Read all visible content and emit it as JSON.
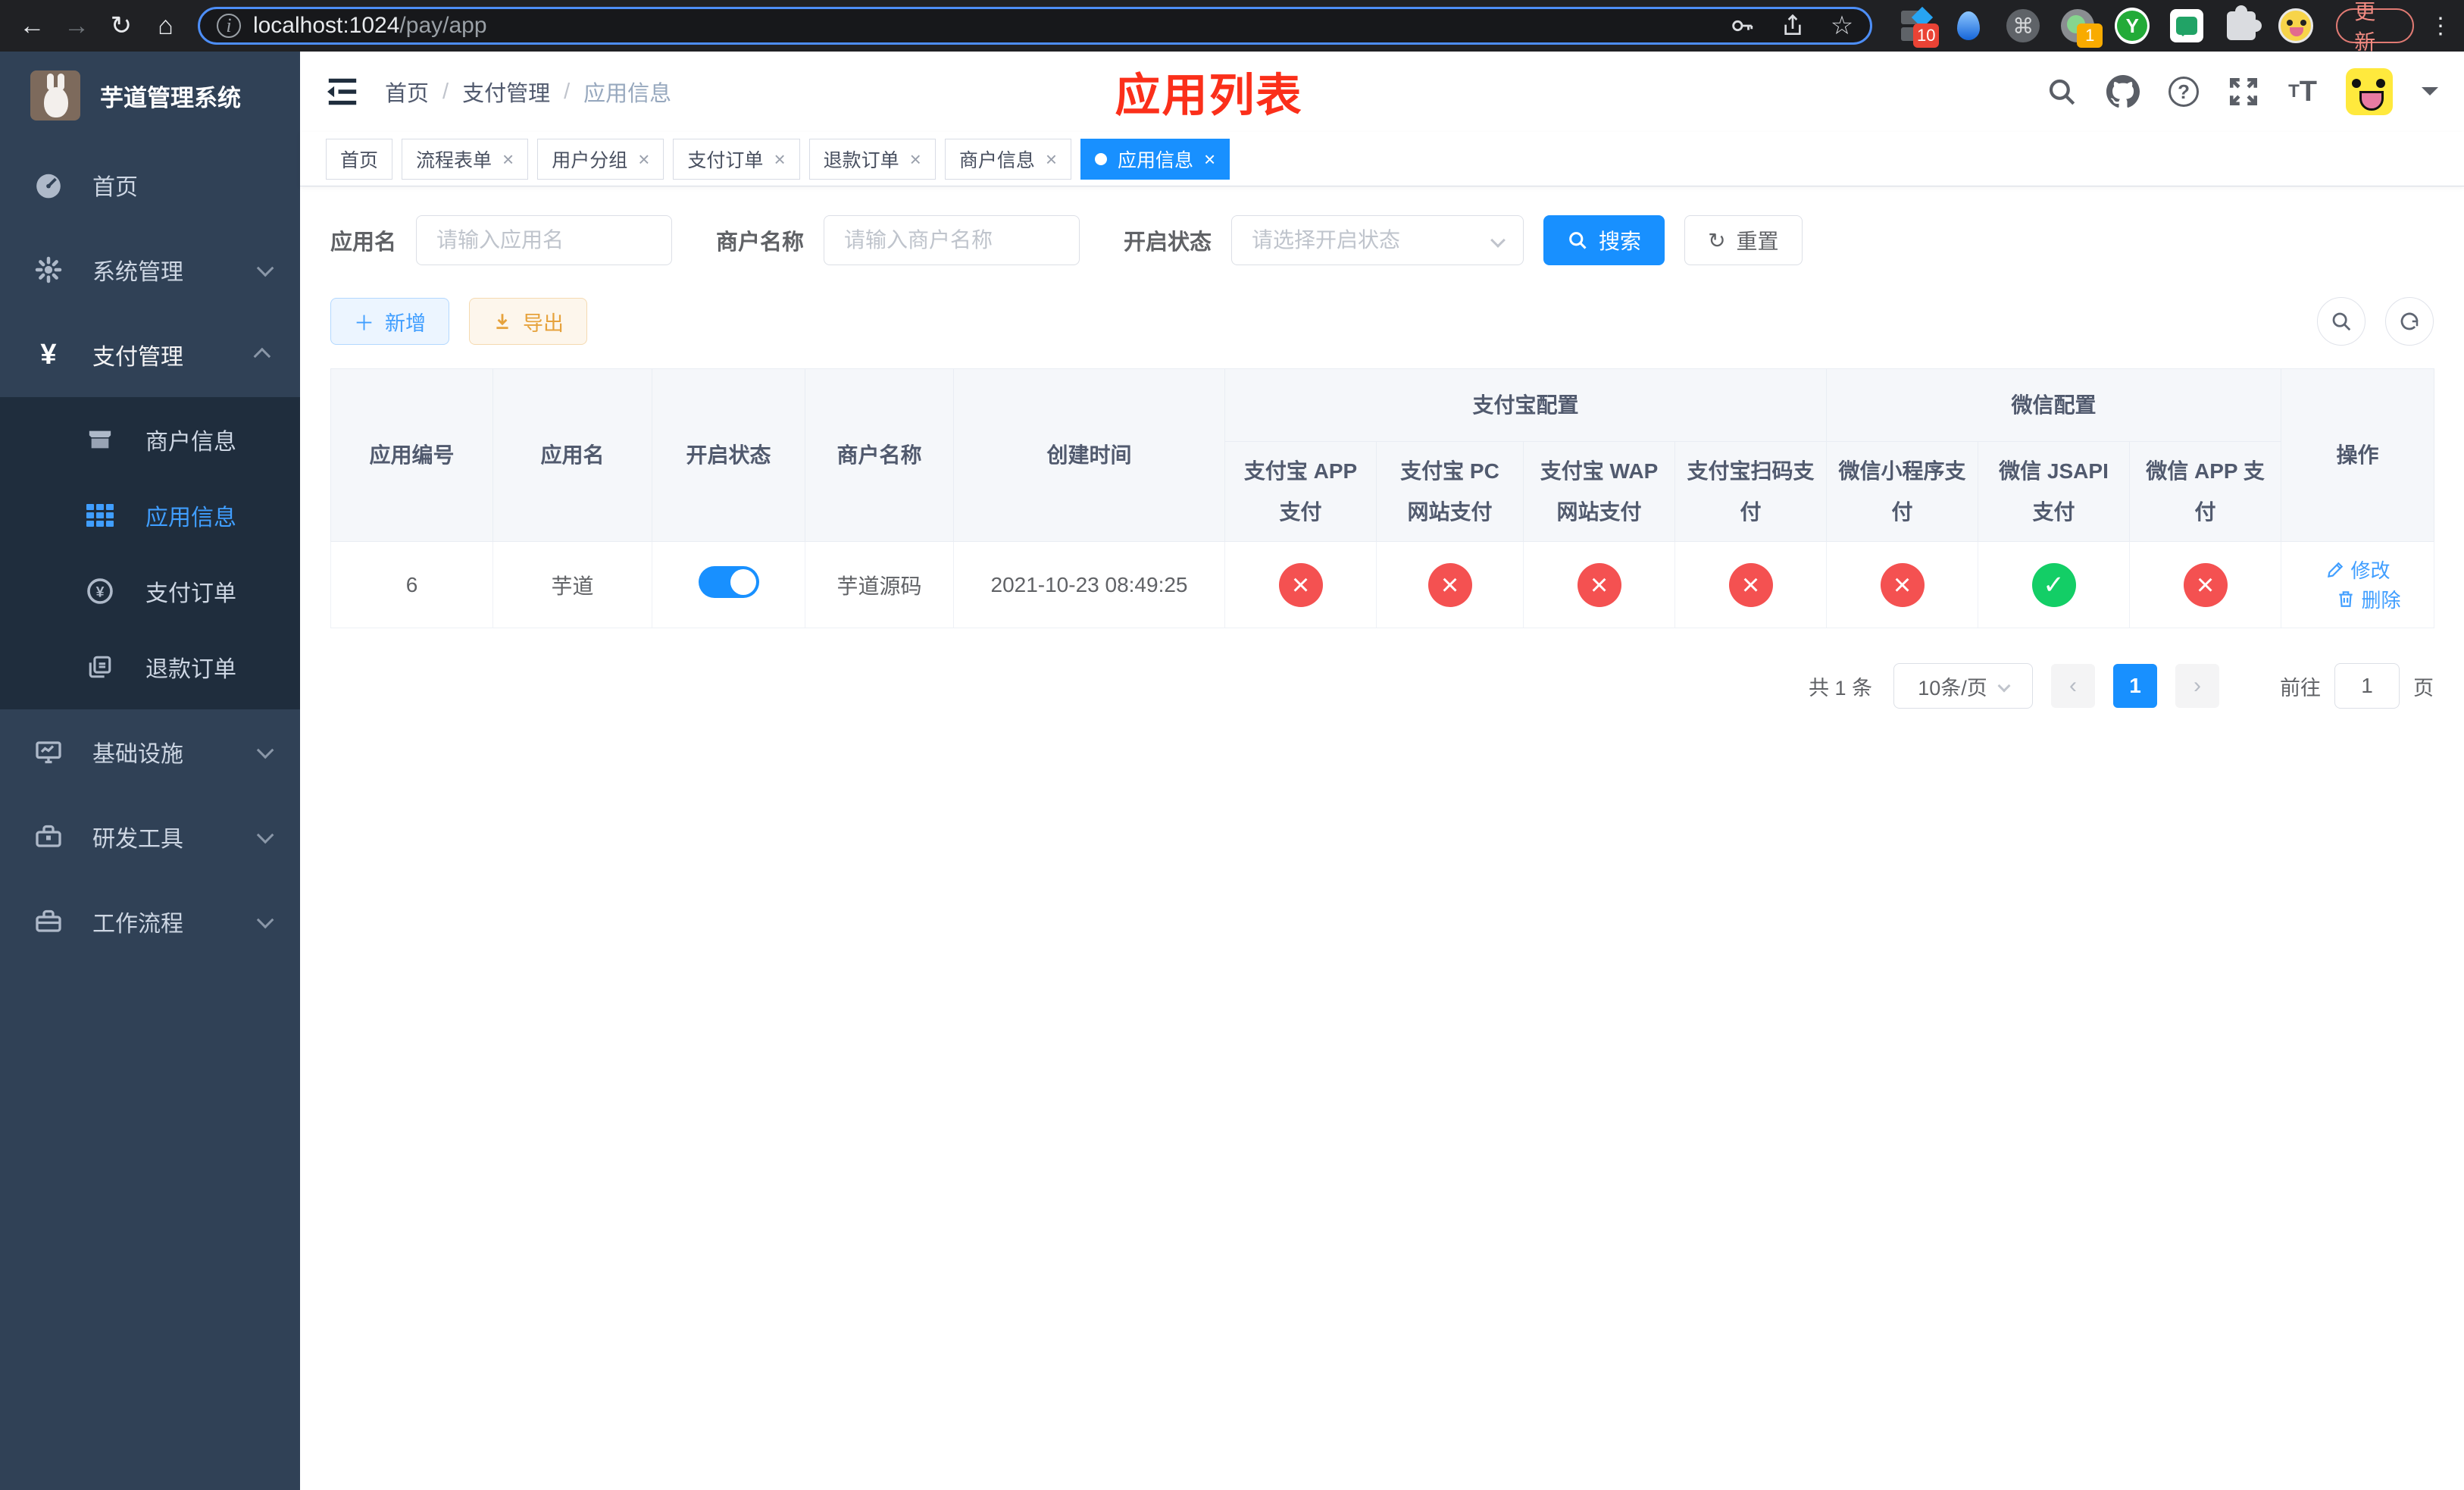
{
  "browser": {
    "url_host": "localhost:1024",
    "url_path": "/pay/app",
    "update_label": "更新",
    "ext_badge_1": "10",
    "ext_badge_2": "1",
    "ext_y_label": "Y"
  },
  "sidebar": {
    "logo_title": "芋道管理系统",
    "items": [
      {
        "label": "首页"
      },
      {
        "label": "系统管理"
      },
      {
        "label": "支付管理"
      },
      {
        "label": "基础设施"
      },
      {
        "label": "研发工具"
      },
      {
        "label": "工作流程"
      }
    ],
    "submenu": [
      {
        "label": "商户信息"
      },
      {
        "label": "应用信息"
      },
      {
        "label": "支付订单"
      },
      {
        "label": "退款订单"
      }
    ]
  },
  "header": {
    "breadcrumb": [
      "首页",
      "支付管理",
      "应用信息"
    ],
    "separator": "/",
    "annotation": "应用列表"
  },
  "tabs": [
    {
      "label": "首页"
    },
    {
      "label": "流程表单"
    },
    {
      "label": "用户分组"
    },
    {
      "label": "支付订单"
    },
    {
      "label": "退款订单"
    },
    {
      "label": "商户信息"
    },
    {
      "label": "应用信息"
    }
  ],
  "tab_close": "×",
  "filters": {
    "app_name_label": "应用名",
    "app_name_placeholder": "请输入应用名",
    "merchant_label": "商户名称",
    "merchant_placeholder": "请输入商户名称",
    "status_label": "开启状态",
    "status_placeholder": "请选择开启状态",
    "search_label": "搜索",
    "reset_label": "重置"
  },
  "toolbar": {
    "add_label": "新增",
    "export_label": "导出"
  },
  "table": {
    "columns": {
      "app_id": "应用编号",
      "app_name": "应用名",
      "status": "开启状态",
      "merchant": "商户名称",
      "created": "创建时间",
      "alipay_group": "支付宝配置",
      "wechat_group": "微信配置",
      "alipay_sub": [
        "支付宝 APP 支付",
        "支付宝 PC 网站支付",
        "支付宝 WAP 网站支付",
        "支付宝扫码支付"
      ],
      "wechat_sub": [
        "微信小程序支付",
        "微信 JSAPI 支付",
        "微信 APP 支付"
      ],
      "actions": "操作"
    },
    "row": {
      "app_id": "6",
      "app_name": "芋道",
      "status": "on",
      "merchant": "芋道源码",
      "created": "2021-10-23 08:49:25",
      "channels": [
        "no",
        "no",
        "no",
        "no",
        "no",
        "yes",
        "no"
      ],
      "edit_label": "修改",
      "delete_label": "删除"
    }
  },
  "pagination": {
    "total_text": "共 1 条",
    "page_size": "10条/页",
    "current_page": "1",
    "goto_label": "前往",
    "goto_value": "1",
    "page_unit": "页"
  },
  "colors": {
    "primary": "#1890ff",
    "link": "#409eff",
    "success": "#13ce66",
    "danger": "#f45151",
    "warning": "#e6a23c",
    "sidebar_bg": "#304156",
    "submenu_bg": "#1f2d3d",
    "annotation_red": "#fb2f1a"
  }
}
